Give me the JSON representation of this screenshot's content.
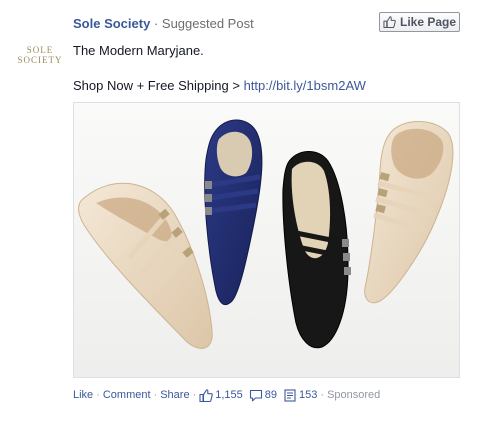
{
  "post": {
    "page_name": "Sole Society",
    "separator": "·",
    "post_type": "Suggested Post",
    "like_page_label": "Like Page",
    "text": "The Modern Maryjane.",
    "shop_text": "Shop Now + Free Shipping > ",
    "shop_link": "http://bit.ly/1bsm2AW"
  },
  "logo": {
    "line1": "SOLE",
    "line2": "SOCIETY",
    "color": "#9a8a5d"
  },
  "footer": {
    "like": "Like",
    "comment": "Comment",
    "share": "Share",
    "likes_count": "1,155",
    "comments_count": "89",
    "shares_count": "153",
    "sponsored": "Sponsored",
    "dot": "·"
  },
  "colors": {
    "link_blue": "#3b5998",
    "nude_patent": "#ecdcc6",
    "navy_suede": "#1f2a6b",
    "black_suede": "#141414"
  },
  "icons": {
    "like_page": "thumbs-up-icon",
    "likes": "thumbs-up-icon",
    "comments": "speech-bubble-icon",
    "shares": "share-doc-icon"
  }
}
